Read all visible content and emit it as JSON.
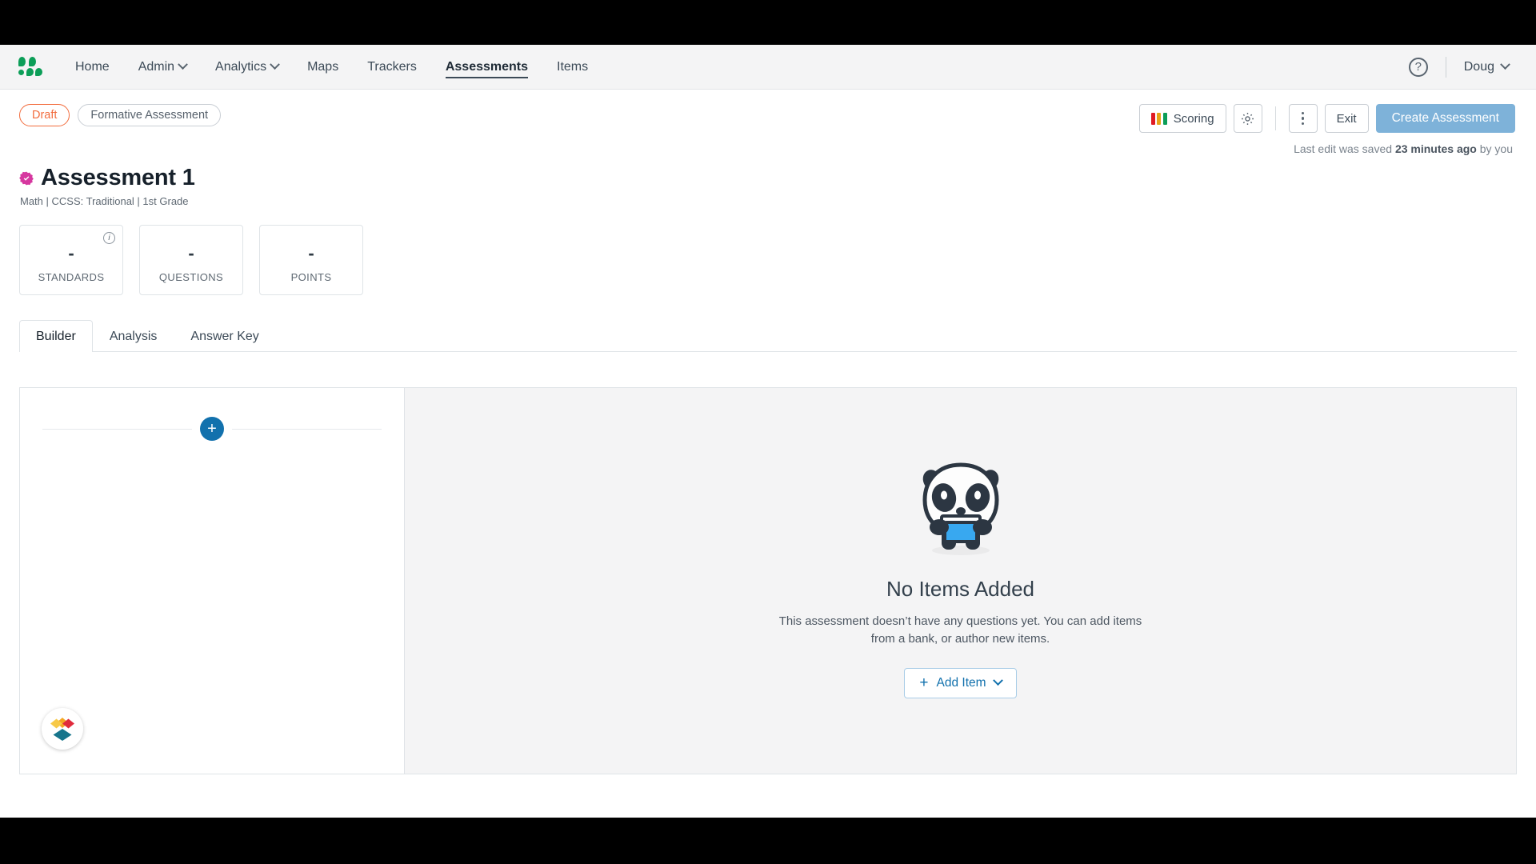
{
  "nav": {
    "logo_icon": "kickup-dots-logo-icon",
    "items": [
      {
        "label": "Home",
        "has_caret": false,
        "active": false
      },
      {
        "label": "Admin",
        "has_caret": true,
        "active": false
      },
      {
        "label": "Analytics",
        "has_caret": true,
        "active": false
      },
      {
        "label": "Maps",
        "has_caret": false,
        "active": false
      },
      {
        "label": "Trackers",
        "has_caret": false,
        "active": false
      },
      {
        "label": "Assessments",
        "has_caret": false,
        "active": true
      },
      {
        "label": "Items",
        "has_caret": false,
        "active": false
      }
    ],
    "help_icon_label": "?",
    "user_name": "Doug"
  },
  "actionbar": {
    "status_pill": "Draft",
    "type_pill": "Formative Assessment",
    "scoring_label": "Scoring",
    "scoring_colors": [
      "#e01b24",
      "#e8a317",
      "#0c9e58"
    ],
    "settings_icon": "gear-icon",
    "more_icon": "kebab-menu-icon",
    "exit_label": "Exit",
    "create_label": "Create Assessment",
    "create_color": "#7eb2d9",
    "saved_prefix": "Last edit was saved ",
    "saved_bold": "23 minutes ago",
    "saved_suffix": " by you"
  },
  "title": {
    "seal_color": "#d6379f",
    "name": "Assessment 1",
    "subtitle": "Math  |  CCSS: Traditional  |  1st Grade"
  },
  "stats": [
    {
      "value": "-",
      "label": "STANDARDS",
      "has_info": true
    },
    {
      "value": "-",
      "label": "QUESTIONS",
      "has_info": false
    },
    {
      "value": "-",
      "label": "POINTS",
      "has_info": false
    }
  ],
  "tabs": [
    {
      "label": "Builder",
      "active": true
    },
    {
      "label": "Analysis",
      "active": false
    },
    {
      "label": "Answer Key",
      "active": false
    }
  ],
  "builder": {
    "add_section_icon": "plus-icon",
    "corner_logo_icon": "diamond-stack-logo-icon"
  },
  "empty_state": {
    "illustration": "panda-with-book-icon",
    "title": "No Items Added",
    "description": "This assessment doesn’t have any questions yet. You can add items from a bank, or author new items.",
    "add_item_label": "Add Item",
    "add_item_plus": "+",
    "add_item_caret": "chevron-down-icon",
    "accent_color": "#1271ad"
  }
}
